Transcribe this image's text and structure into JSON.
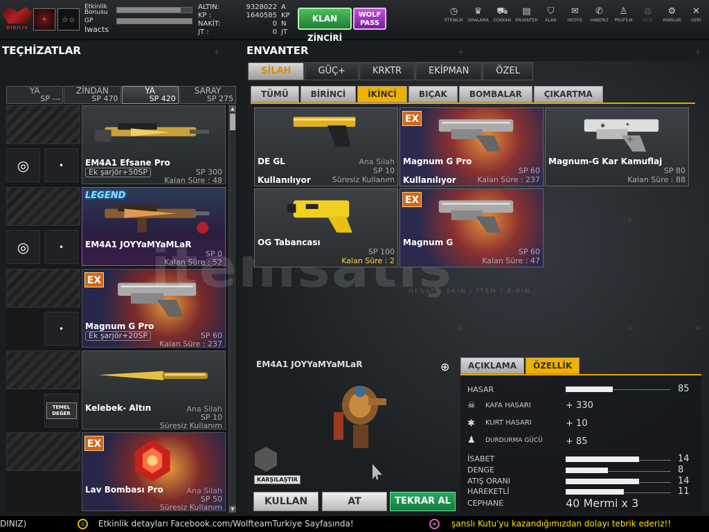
{
  "topbar": {
    "logo_text": "DIRILIS",
    "badge2": "☆☆",
    "profile": {
      "event_label": "Etkinlik\nBonusu",
      "event_fill": 0.85,
      "gp_label": "GP",
      "gp_fill": 1.0,
      "username": "Iwacts"
    },
    "currency": [
      {
        "key": "ALTIN:",
        "value": "9328022",
        "unit": "A"
      },
      {
        "key": "KP :",
        "value": "1640585",
        "unit": "KP"
      },
      {
        "key": "NAKİT:",
        "value": "0",
        "unit": "N"
      },
      {
        "key": "JT :",
        "value": "0",
        "unit": "JT"
      }
    ],
    "klan_button": "KLAN ZİNCİRİ",
    "wolf_pass_button": "WOLF PASS",
    "menu": [
      {
        "label": "ETKİNLİK",
        "icon": "timer-icon",
        "glyph": "◷"
      },
      {
        "label": "SIRALAMA",
        "icon": "rank-icon",
        "glyph": "♛"
      },
      {
        "label": "DÜKKAN",
        "icon": "cart-icon",
        "glyph": "⛟"
      },
      {
        "label": "ENVANTER",
        "icon": "inventory-icon",
        "glyph": "▤"
      },
      {
        "label": "KLAN",
        "icon": "clan-shield-icon",
        "glyph": "⛉"
      },
      {
        "label": "HEDİYE",
        "icon": "gift-icon",
        "glyph": "✉"
      },
      {
        "label": "HABERCİ",
        "icon": "megaphone-icon",
        "glyph": "✆"
      },
      {
        "label": "PROFİLM",
        "icon": "profile-icon",
        "glyph": "♙"
      },
      {
        "label": "WEB",
        "icon": "globe-icon",
        "glyph": "◍"
      },
      {
        "label": "AYARLAR",
        "icon": "gear-icon",
        "glyph": "⚙"
      },
      {
        "label": "GERİ",
        "icon": "back-icon",
        "glyph": "✕"
      }
    ]
  },
  "equipment": {
    "title": "TEÇHİZATLAR",
    "slots": [
      {
        "name": "YA",
        "sp": "SP ---"
      },
      {
        "name": "ZİNDAN",
        "sp": "SP 470"
      },
      {
        "name": "YA",
        "sp": "SP 420"
      },
      {
        "name": "SARAY",
        "sp": "SP 275"
      }
    ],
    "active_slot": 2,
    "items": [
      {
        "name": "EM4A1 Efsane Pro",
        "extra": "Ek şarjör+50SP",
        "sp": "SP 300",
        "sure": "Kalan Süre : 48",
        "kind": "gold-rifle"
      },
      {
        "name": "EM4A1 JOYYaMYaMLaR",
        "sp": "SP 0",
        "sure": "Kalan Süre : 52",
        "tag": "LEGEND",
        "kind": "legend-rifle"
      },
      {
        "name": "Magnum G Pro",
        "extra": "Ek şarjör+20SP",
        "sp": "SP 60",
        "sure": "Kalan Süre : 237",
        "tag": "EX",
        "kind": "revolver"
      },
      {
        "name": "Kelebek- Altın",
        "cat": "Ana Silah",
        "sp": "SP 10",
        "sure": "Süresiz Kullanım",
        "kind": "knife"
      },
      {
        "name": "Lav Bombası Pro",
        "cat": "Ana Silah",
        "sp": "SP 50",
        "sure": "Süresiz Kullanım",
        "tag": "EX",
        "kind": "bomb"
      }
    ],
    "temel_label": "TEMEL\nDEĞER"
  },
  "inventory": {
    "title": "ENVANTER",
    "tabs": [
      "SİLAH",
      "GÜÇ+",
      "KRKTR",
      "EKİPMAN",
      "ÖZEL"
    ],
    "active_tab": 0,
    "subtabs": [
      "TÜMÜ",
      "BİRİNCİ",
      "İKİNCİ",
      "BIÇAK",
      "BOMBALAR",
      "ÇIKARTMA"
    ],
    "active_subtab": 2,
    "items": [
      {
        "name": "DE GL",
        "cat": "Ana Silah",
        "sp": "SP 10",
        "status": "Kullanılıyor",
        "sure": "Süresiz Kullanım",
        "kind": "gold-pistol"
      },
      {
        "name": "Magnum G Pro",
        "sp": "SP 60",
        "status": "Kullanılıyor",
        "sure": "Kalan Süre : 237",
        "tag": "EX",
        "kind": "revolver"
      },
      {
        "name": "Magnum-G Kar Kamuflaj",
        "sp": "SP 80",
        "sure": "Kalan Süre : 88",
        "kind": "revolver-snow"
      },
      {
        "name": "OG Tabancası",
        "sp": "SP 100",
        "sure": "Kalan Süre : 2",
        "sure_highlight": true,
        "kind": "taser"
      },
      {
        "name": "Magnum G",
        "sp": "SP 60",
        "sure": "Kalan Süre : 47",
        "tag": "EX",
        "kind": "revolver"
      }
    ]
  },
  "detail": {
    "item_name": "EM4A1 JOYYaMYaMLaR",
    "compare_label": "KARŞILAŞTIR",
    "tabs": [
      "AÇIKLAMA",
      "ÖZELLİK"
    ],
    "active_tab": 1,
    "stats": {
      "hasar": {
        "label": "HASAR",
        "value": "85",
        "fill": 0.45
      },
      "kafa": {
        "label": "KAFA HASARI",
        "value": "+ 330"
      },
      "kurt": {
        "label": "KURT HASARI",
        "value": "+ 10"
      },
      "durdurma": {
        "label": "DURDURMA GÜCÜ",
        "value": "+ 85"
      },
      "isabet": {
        "label": "İSABET",
        "value": "14",
        "fill": 0.7
      },
      "denge": {
        "label": "DENGE",
        "value": "8",
        "fill": 0.4
      },
      "atis": {
        "label": "ATIŞ ORANI",
        "value": "14",
        "fill": 0.7
      },
      "hareket": {
        "label": "HAREKETLİ",
        "value": "11",
        "fill": 0.55
      },
      "cephane": {
        "label": "CEPHANE",
        "value": "40 Mermi x 3"
      }
    },
    "buttons": {
      "use": "KULLAN",
      "drop": "AT",
      "rebuy": "TEKRAR AL"
    }
  },
  "ticker": {
    "t1": "DINIZ)",
    "t2": "Etkinlik detayları Facebook.com/WolfteamTurkiye Sayfasında!",
    "t3": "şanslı Kutu'yu kazandığımızdan dolayı tebrik ederiz!!"
  },
  "watermark": {
    "main": "itemsatış",
    "sub": "HESAP / SKIN / ITEM / E-PIN"
  }
}
